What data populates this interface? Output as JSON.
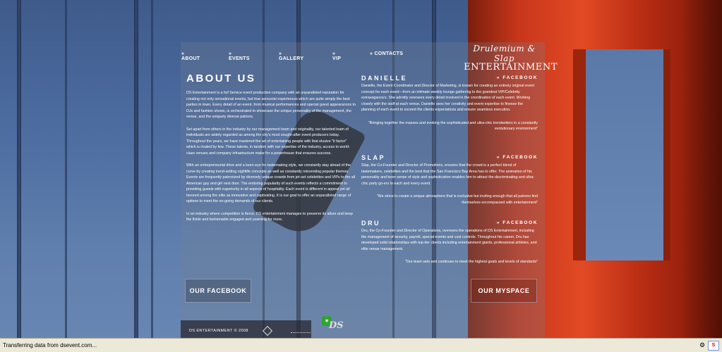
{
  "nav": {
    "about": "» ABOUT",
    "events": "» EVENTS",
    "gallery": "» GALLERY",
    "vip": "» VIP",
    "contacts": "» CONTACTS"
  },
  "logo": {
    "script": "Drulemium & Slap",
    "entertainment": "ENTERTAINMENT"
  },
  "about": {
    "title": "ABOUT US",
    "p1": "DS Entertainment is a full Service event production company with an unparalleled reputation for creating not only sensational events, but true sensorial experiences which are quite simply the best parties in town. Every detail of an event, from musical performances and special guest appearances to DJs and fashion shows, is orchestrated to showcase the unique personality of the management, the venue, and the uniquely diverse patrons.",
    "p2": "Set apart from others in the industry by our management team and originality, our talented team of individuals are widely regarded as among the city's most sought-after event producers today. Throughout the years, we have mastered the art of entertaining people with that elusive \"it factor\" which is rivaled by few. These talents, in tandem with our expertise of the industry, access to world-class venues and company infrastructure make for a powerhouse that ensures success.",
    "p3": "With an entrepreneurial drive and a keen eye for tastemaking style, we constantly stay ahead of the curve by creating trend-setting nightlife concepts as well as constantly reinventing popular themes. Events are frequently patronized by diversely unique crowds from jet-set celebrities and VIPs to the all American guy and girl next door. The enduring popularity of such events reflects a commitment to providing guests with superiority in all aspects of hospitality. Each event is different in appeal yet all favored among the elite as innovative and captivating. It is our goal to offer an unparalleled range of options to meet the on-going demands of our clients.",
    "p4": "In an industry where competition is fierce, DS entertainment manages to preserve its allure and keep the fickle and fashionable engaged and yearning for more."
  },
  "members": [
    {
      "name": "DANIELLE",
      "facebook": "» FACEBOOK",
      "desc": "Danielle, the Event Coordinator and Director of Marketing, is known for creating an entirely original event concept for each event—from an intimate weekly lounge gathering to the grandest VIP/Celebrity extravaganza's. She adroitly oversees every detail involved in the coordination of each event. Working closely with the staff at each venue, Danielle uses her creativity and event expertise to finesse the planning of each event to exceed the clients expectations and ensure seamless execution.",
      "quote": "\"Bringing together the masses and evoking the sophisticated and ultra-chic trendsetters in a constantly evolutionary environment\""
    },
    {
      "name": "SLAP",
      "facebook": "» FACEBOOK",
      "desc": "Slap, the Co-Founder and Director of Promotions, ensures that the crowd is a perfect blend of tastemakers, celebrities and the best that the San Francisco Bay Area has to offer. The animation of his personality and keen sense of style and sophistication enables him to attract the discriminating and ultra-chic party go-ers to each and every event.",
      "quote": "\"We strive to create a unique atmosphere that is exclusive but inviting enough that all patrons find themselves encompassed with entertainment\""
    },
    {
      "name": "DRU",
      "facebook": "» FACEBOOK",
      "desc": "Dru, the Co-Founder and Director of Operations, oversees the operations of DS Entertainment, including the management of security, payroll, special events and cost controls. Throughout his career, Dru has developed solid relationships with top-tier clients including entertainment giants, professional athletes, and elite venue management.",
      "quote": "\"Our team sets and continues to meet the highest goals and levels of standards\""
    }
  ],
  "buttons": {
    "facebook": "OUR FACEBOOK",
    "myspace": "OUR MYSPACE"
  },
  "footer": {
    "copyright": "DS ENTERTAINMENT © 2008",
    "badge": "DS"
  },
  "status": {
    "text": "Transferring data from dsevent.com..."
  }
}
